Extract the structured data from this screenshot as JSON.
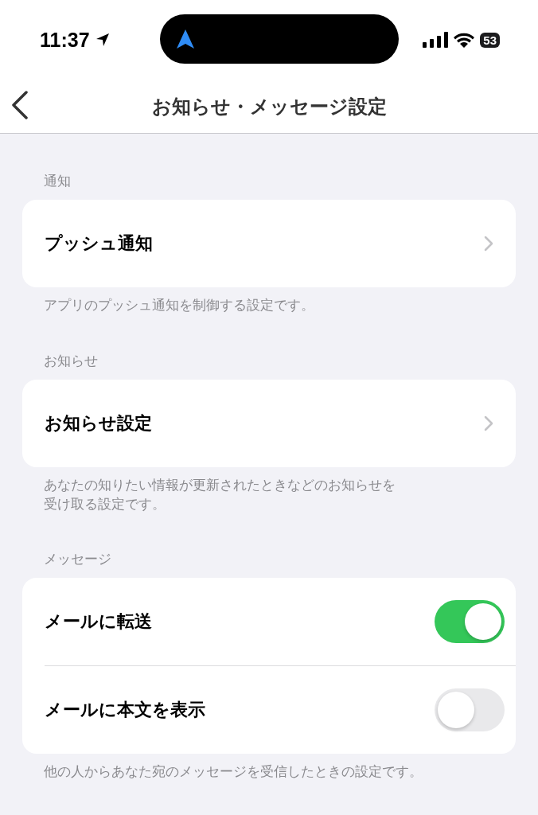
{
  "status_bar": {
    "time": "11:37",
    "battery": "53"
  },
  "nav": {
    "title": "お知らせ・メッセージ設定"
  },
  "sections": [
    {
      "header": "通知",
      "rows": [
        {
          "kind": "link",
          "label": "プッシュ通知"
        }
      ],
      "footer": [
        "アプリのプッシュ通知を制御する設定です。"
      ]
    },
    {
      "header": "お知らせ",
      "rows": [
        {
          "kind": "link",
          "label": "お知らせ設定"
        }
      ],
      "footer": [
        "あなたの知りたい情報が更新されたときなどのお知らせを",
        "受け取る設定です。"
      ]
    },
    {
      "header": "メッセージ",
      "rows": [
        {
          "kind": "toggle",
          "label": "メールに転送",
          "on": true
        },
        {
          "kind": "toggle",
          "label": "メールに本文を表示",
          "on": false
        }
      ],
      "footer": [
        "他の人からあなた宛のメッセージを受信したときの設定です。"
      ]
    }
  ]
}
